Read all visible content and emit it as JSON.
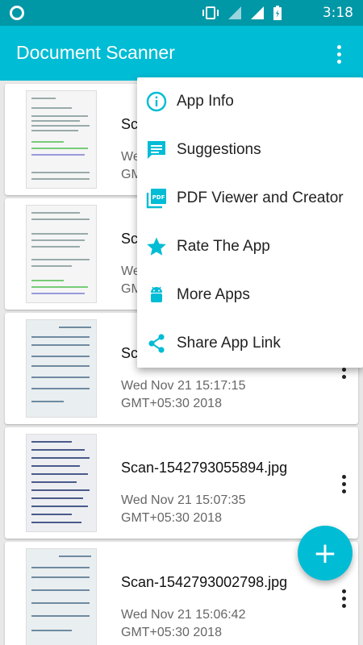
{
  "status_bar": {
    "time": "3:18"
  },
  "app_bar": {
    "title": "Document Scanner"
  },
  "colors": {
    "primary": "#00bcd4",
    "primary_dark": "#0097a7"
  },
  "documents": [
    {
      "name": "Sc",
      "date": "Wed",
      "time_line": "GMT"
    },
    {
      "name": "Sc",
      "date": "Wed",
      "time_line": "GMT"
    },
    {
      "name": "Sc",
      "date": "Wed Nov 21 15:17:15",
      "time_line": "GMT+05:30 2018"
    },
    {
      "name": "Scan-1542793055894.jpg",
      "date": "Wed Nov 21 15:07:35",
      "time_line": "GMT+05:30 2018"
    },
    {
      "name": "Scan-1542793002798.jpg",
      "date": "Wed Nov 21 15:06:42",
      "time_line": "GMT+05:30 2018"
    }
  ],
  "overflow_menu": {
    "items": [
      {
        "label": "App Info",
        "icon": "info-icon"
      },
      {
        "label": "Suggestions",
        "icon": "feedback-icon"
      },
      {
        "label": "PDF Viewer and Creator",
        "icon": "pdf-icon"
      },
      {
        "label": "Rate The App",
        "icon": "star-icon"
      },
      {
        "label": "More Apps",
        "icon": "android-icon"
      },
      {
        "label": "Share App Link",
        "icon": "share-icon"
      }
    ]
  },
  "fab": {
    "label": "+"
  }
}
